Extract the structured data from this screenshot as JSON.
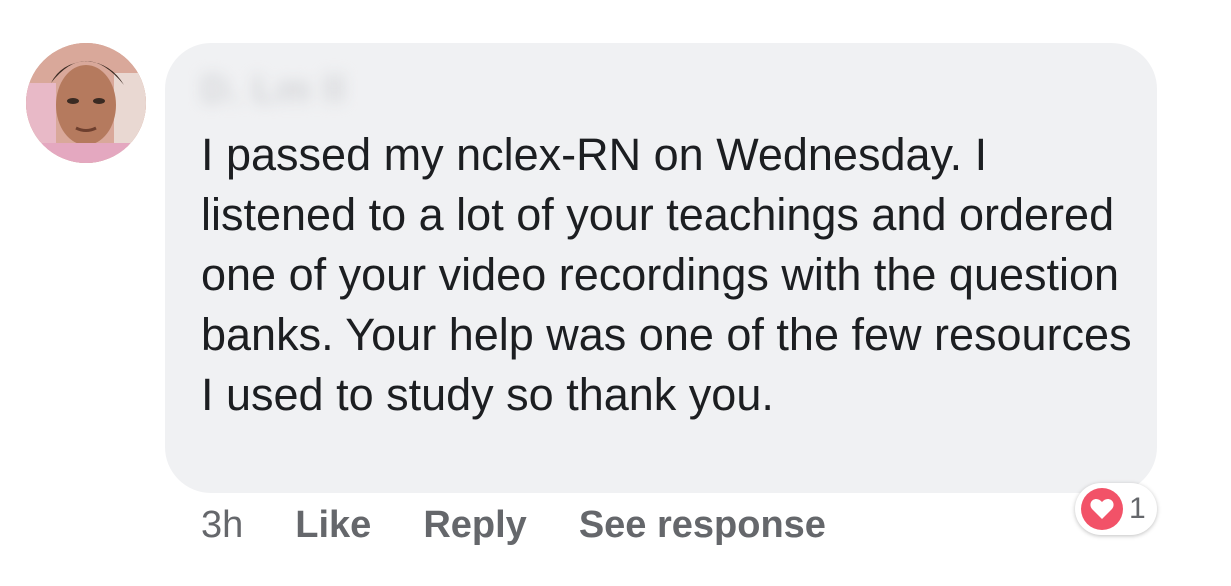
{
  "comment": {
    "author_name": "D. Lm  ll",
    "text": "I passed my nclex-RN on Wednesday. I listened to a lot of your teachings and ordered one of your video recordings with the question banks. Your help was one of the few resources I used to study so thank you."
  },
  "actions": {
    "timestamp": "3h",
    "like_label": "Like",
    "reply_label": "Reply",
    "see_response_label": "See response"
  },
  "reaction": {
    "icon": "heart-icon",
    "count": "1",
    "color": "#f25268"
  },
  "colors": {
    "bubble_bg": "#f0f1f3",
    "text": "#1c1e21",
    "secondary_text": "#65676b"
  }
}
